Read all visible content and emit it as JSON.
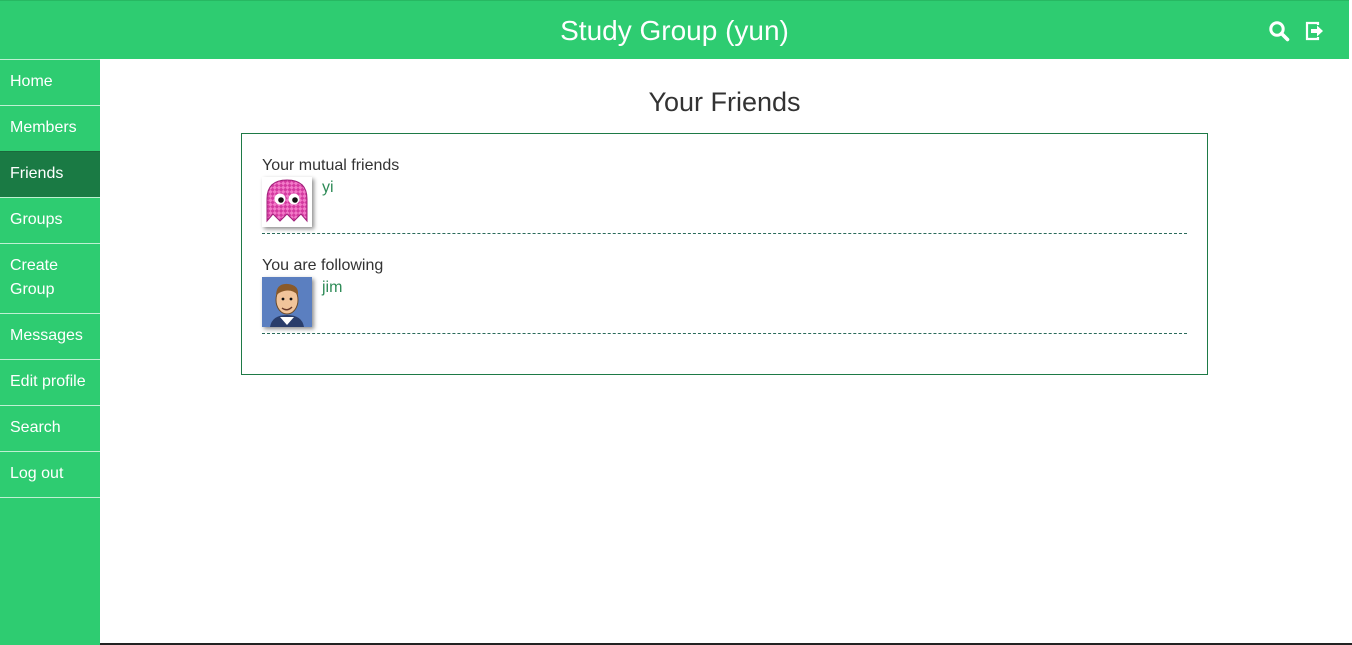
{
  "header": {
    "title": "Study Group (yun)",
    "search_icon": "search-icon",
    "logout_icon": "logout-icon",
    "background": "#2ecc71"
  },
  "sidebar": {
    "items": [
      {
        "label": "Home",
        "active": false
      },
      {
        "label": "Members",
        "active": false
      },
      {
        "label": "Friends",
        "active": true
      },
      {
        "label": "Groups",
        "active": false
      },
      {
        "label": "Create Group",
        "active": false
      },
      {
        "label": "Messages",
        "active": false
      },
      {
        "label": "Edit profile",
        "active": false
      },
      {
        "label": "Search",
        "active": false
      },
      {
        "label": "Log out",
        "active": false
      }
    ],
    "active_color": "#1a7a44"
  },
  "main": {
    "title": "Your Friends",
    "sections": [
      {
        "label": "Your mutual friends",
        "friends": [
          {
            "name": "yi",
            "avatar": "pink-ghost-avatar"
          }
        ]
      },
      {
        "label": "You are following",
        "friends": [
          {
            "name": "jim",
            "avatar": "cartoon-man-avatar"
          }
        ]
      }
    ],
    "link_color": "#2e8b57",
    "border_color": "#1e7a46"
  }
}
